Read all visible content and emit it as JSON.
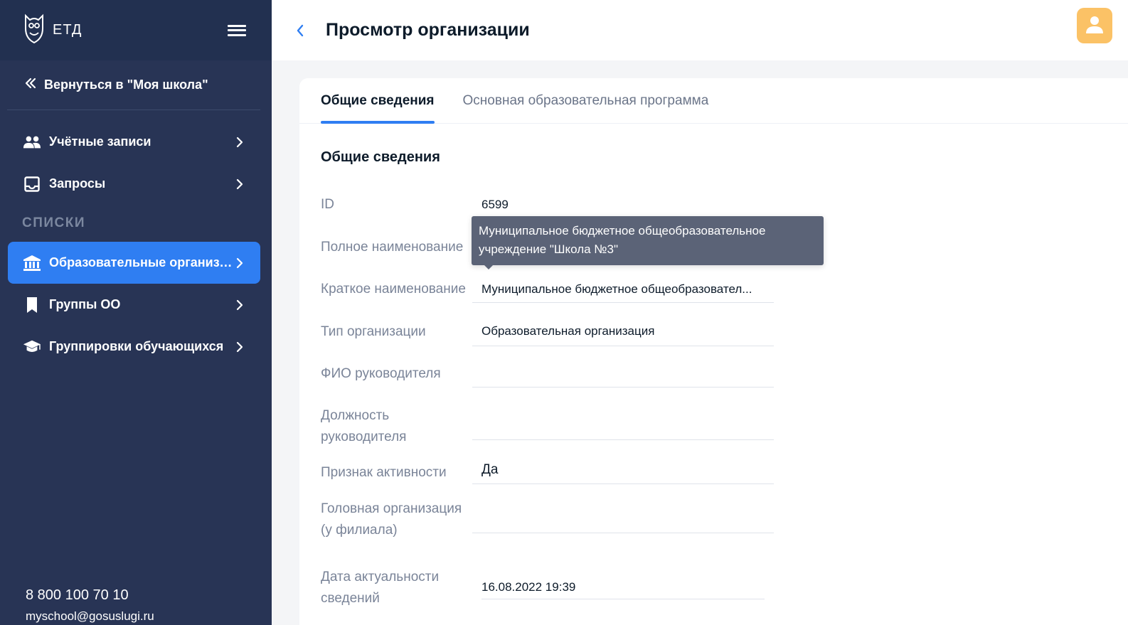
{
  "app": {
    "logo_text": "ЕТД"
  },
  "sidebar": {
    "back_label": "Вернуться в \"Моя школа\"",
    "items_top": [
      {
        "label": "Учётные записи",
        "icon": "users-icon"
      },
      {
        "label": "Запросы",
        "icon": "inbox-icon"
      }
    ],
    "section_label": "СПИСКИ",
    "items_lists": [
      {
        "label": "Образовательные организа...",
        "icon": "institution-icon",
        "active": true
      },
      {
        "label": "Группы ОО",
        "icon": "bookmark-icon"
      },
      {
        "label": "Группировки обучающихся",
        "icon": "graduation-cap-icon"
      }
    ],
    "footer": {
      "phone": "8 800 100 70 10",
      "email": "myschool@gosuslugi.ru"
    }
  },
  "header": {
    "title": "Просмотр организации"
  },
  "tabs": [
    "Общие сведения",
    "Основная образовательная программа"
  ],
  "section_title": "Общие сведения",
  "fields": {
    "id": {
      "label": "ID",
      "value": "6599"
    },
    "full_name": {
      "label": "Полное наименование",
      "value": ""
    },
    "short_name": {
      "label": "Краткое наименование",
      "value": "Муниципальное бюджетное общеобразовател..."
    },
    "org_type": {
      "label": "Тип организации",
      "value": "Образовательная организация"
    },
    "head_name": {
      "label": "ФИО руководителя",
      "value": ""
    },
    "head_position": {
      "label": "Должность руководителя",
      "value": ""
    },
    "active": {
      "label": "Признак активности",
      "value": "Да"
    },
    "parent_org": {
      "label": "Головная организация (у филиала)",
      "value": ""
    },
    "actual_date": {
      "label": "Дата актуальности сведений",
      "value": "16.08.2022 19:39"
    }
  },
  "tooltip": {
    "text": "Муниципальное бюджетное общеобразовательное учреждение \"Школа №3\""
  },
  "colors": {
    "sidebar_bg": "#283455",
    "accent": "#2f7ef2",
    "avatar": "#fbc266"
  }
}
